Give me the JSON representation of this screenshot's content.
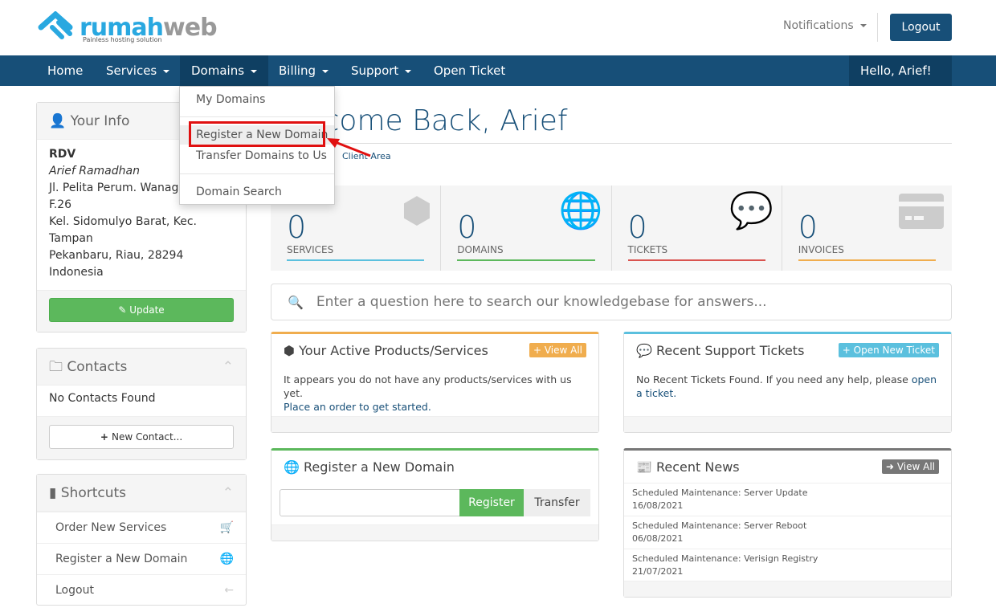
{
  "brand": {
    "name_a": "rumah",
    "name_b": "web",
    "tagline": "Painless hosting solution"
  },
  "header": {
    "notifications": "Notifications",
    "logout": "Logout"
  },
  "nav": {
    "items": [
      "Home",
      "Services",
      "Domains",
      "Billing",
      "Support",
      "Open Ticket"
    ],
    "user": "Hello, Arief!"
  },
  "domains_menu": {
    "items": [
      "My Domains",
      "Register a New Domain",
      "Transfer Domains to Us",
      "Domain Search"
    ],
    "highlighted": "Register a New Domain"
  },
  "sidebar": {
    "info": {
      "title": "Your Info",
      "company": "RDV",
      "name": "Arief Ramadhan",
      "lines": [
        "Jl. Pelita Perum. Wanagriya F.26",
        "Kel. Sidomulyo Barat, Kec. Tampan",
        "Pekanbaru, Riau, 28294",
        "Indonesia"
      ],
      "update": "Update"
    },
    "contacts": {
      "title": "Contacts",
      "empty": "No Contacts Found",
      "new": "New Contact..."
    },
    "shortcuts": {
      "title": "Shortcuts",
      "items": [
        "Order New Services",
        "Register a New Domain",
        "Logout"
      ]
    }
  },
  "main": {
    "title": "Welcome Back, Arief",
    "breadcrumb": "Client Area",
    "tiles": [
      {
        "value": "0",
        "label": "SERVICES",
        "color": "#5bc0de"
      },
      {
        "value": "0",
        "label": "DOMAINS",
        "color": "#5cb85c"
      },
      {
        "value": "0",
        "label": "TICKETS",
        "color": "#d9534f"
      },
      {
        "value": "0",
        "label": "INVOICES",
        "color": "#f0ad4e"
      }
    ],
    "kb_placeholder": "Enter a question here to search our knowledgebase for answers...",
    "products": {
      "title": "Your Active Products/Services",
      "badge": "View All",
      "text": "It appears you do not have any products/services with us yet.",
      "link": "Place an order to get started."
    },
    "tickets": {
      "title": "Recent Support Tickets",
      "badge": "Open New Ticket",
      "text": "No Recent Tickets Found. If you need any help, please",
      "link": "open a ticket."
    },
    "register": {
      "title": "Register a New Domain",
      "register": "Register",
      "transfer": "Transfer"
    },
    "news": {
      "title": "Recent News",
      "badge": "View All",
      "items": [
        {
          "title": "Scheduled Maintenance: Server Update",
          "date": "16/08/2021"
        },
        {
          "title": "Scheduled Maintenance: Server Reboot",
          "date": "06/08/2021"
        },
        {
          "title": "Scheduled Maintenance: Verisign Registry",
          "date": "21/07/2021"
        }
      ]
    }
  }
}
